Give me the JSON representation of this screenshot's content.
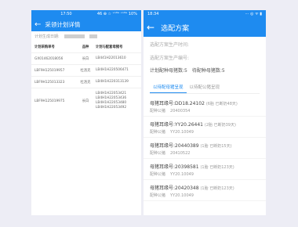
{
  "left": {
    "status": {
      "time": "17:50",
      "icons": "46 ⊕ ☆ ᵛᵒˡᵗᵉ ᵛᵒˡᵗᵉ 10%"
    },
    "title": "采领计划详情",
    "code_label": "计划生成日期:",
    "columns": [
      "计划采购单号",
      "品种",
      "计划与配套母猪号"
    ],
    "rows": [
      {
        "order": "GX01462018056",
        "variety": "长白",
        "codes": [
          "LB441H22013610"
        ]
      },
      {
        "order": "LBF9H125019957",
        "variety": "杜洛克",
        "codes": [
          "LB4H1H220506471"
        ]
      },
      {
        "order": "LBF9H125013323",
        "variety": "杜洛克",
        "codes": [
          "LB4H1H220313139"
        ]
      },
      {
        "order": "LBF9H125019975",
        "variety": "长白",
        "codes": [
          "LB4H1H22053421",
          "LB4H1H22053436",
          "LB4H1H22053480",
          "LB4H1H22053492"
        ]
      }
    ]
  },
  "right": {
    "status": {
      "time": "18:34",
      "icons": "⋯ ◎ ᯤ ▮"
    },
    "title": "选配方案",
    "plan_line": "选配方案生产时间:",
    "plan_sub": "选配方案生产编号:",
    "count_a": "计划配种母猪数:5",
    "count_b": "待配种母猪数:5",
    "tabs": [
      "以待配母猪呈现",
      "以待配公猪呈现"
    ],
    "items": [
      {
        "title": "母猪耳缘号:DD18.24102",
        "note": "(6胎 已断奶48天)",
        "label": "配种公猪",
        "value": "20400354"
      },
      {
        "title": "母猪耳缘号:YY20.26441",
        "note": "(2胎 已断奶39天)",
        "label": "配种公猪",
        "value": "YY20.10049"
      },
      {
        "title": "母猪耳缘号:20440389",
        "note": "(1胎 已断奶15天)",
        "label": "配种公猪",
        "value": "20410522"
      },
      {
        "title": "母猪耳缘号:20398581",
        "note": "(1胎 已断奶123天)",
        "label": "配种公猪",
        "value": "YY20.10049"
      },
      {
        "title": "母猪耳缘号:20420348",
        "note": "(1胎 已断奶123天)",
        "label": "配种公猪",
        "value": "YY20.10049"
      }
    ]
  }
}
